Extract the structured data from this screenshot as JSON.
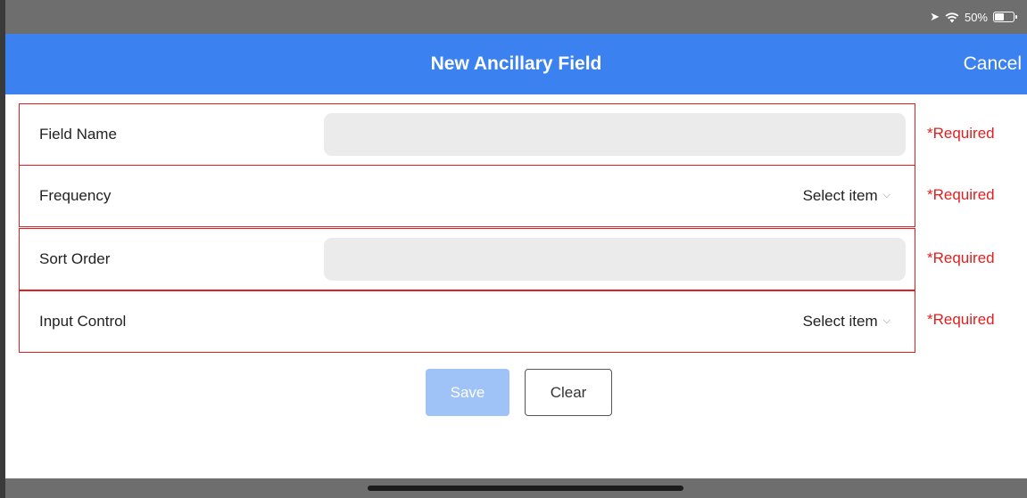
{
  "status_bar": {
    "battery_text": "50%",
    "battery_level": 0.5
  },
  "nav": {
    "title": "New Ancillary Field",
    "cancel_label": "Cancel"
  },
  "form": {
    "rows": [
      {
        "label": "Field Name",
        "type": "text",
        "value": "",
        "required_text": "*Required"
      },
      {
        "label": "Frequency",
        "type": "select",
        "value": "Select item",
        "required_text": "*Required"
      },
      {
        "label": "Sort Order",
        "type": "text",
        "value": "",
        "required_text": "*Required"
      },
      {
        "label": "Input Control",
        "type": "select",
        "value": "Select item",
        "required_text": "*Required"
      }
    ]
  },
  "buttons": {
    "save_label": "Save",
    "clear_label": "Clear"
  },
  "colors": {
    "nav_bg": "#3b82f0",
    "error": "#e02020",
    "save_disabled": "#9fc2f7"
  }
}
